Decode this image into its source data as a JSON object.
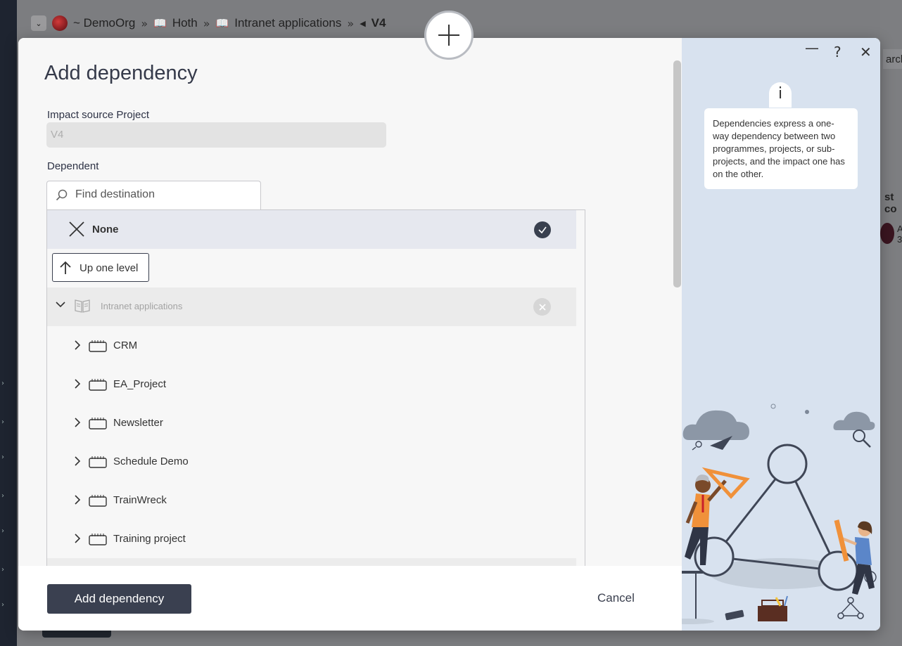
{
  "background": {
    "breadcrumb": {
      "org": "~ DemoOrg",
      "items": [
        "Hoth",
        "Intranet applications"
      ],
      "current": "V4",
      "separator": "»"
    },
    "right_partial": {
      "search": "arch",
      "heading": "st co",
      "avatar_text": "A",
      "avatar_sub": "3"
    }
  },
  "add_button_icon": "plus-icon",
  "dialog": {
    "title": "Add dependency",
    "source_label": "Impact source Project",
    "source_value": "V4",
    "dependent_label": "Dependent",
    "search_placeholder": "Find destination",
    "none_label": "None",
    "up_one_level": "Up one level",
    "parent": "Intranet applications",
    "children": [
      "CRM",
      "EA_Project",
      "Newsletter",
      "Schedule Demo",
      "TrainWreck",
      "Training project"
    ],
    "primary_button": "Add dependency",
    "cancel_button": "Cancel"
  },
  "help": {
    "minimize": "—",
    "help": "?",
    "close": "✕",
    "info": "i",
    "text": "Dependencies express a one-way dependency between two programmes, projects, or sub-projects, and the impact one has on the other."
  },
  "colors": {
    "primary": "#3a4050",
    "help_bg": "#d8e2ef",
    "accent_orange": "#f0913a",
    "accent_blue": "#5b86c9"
  }
}
